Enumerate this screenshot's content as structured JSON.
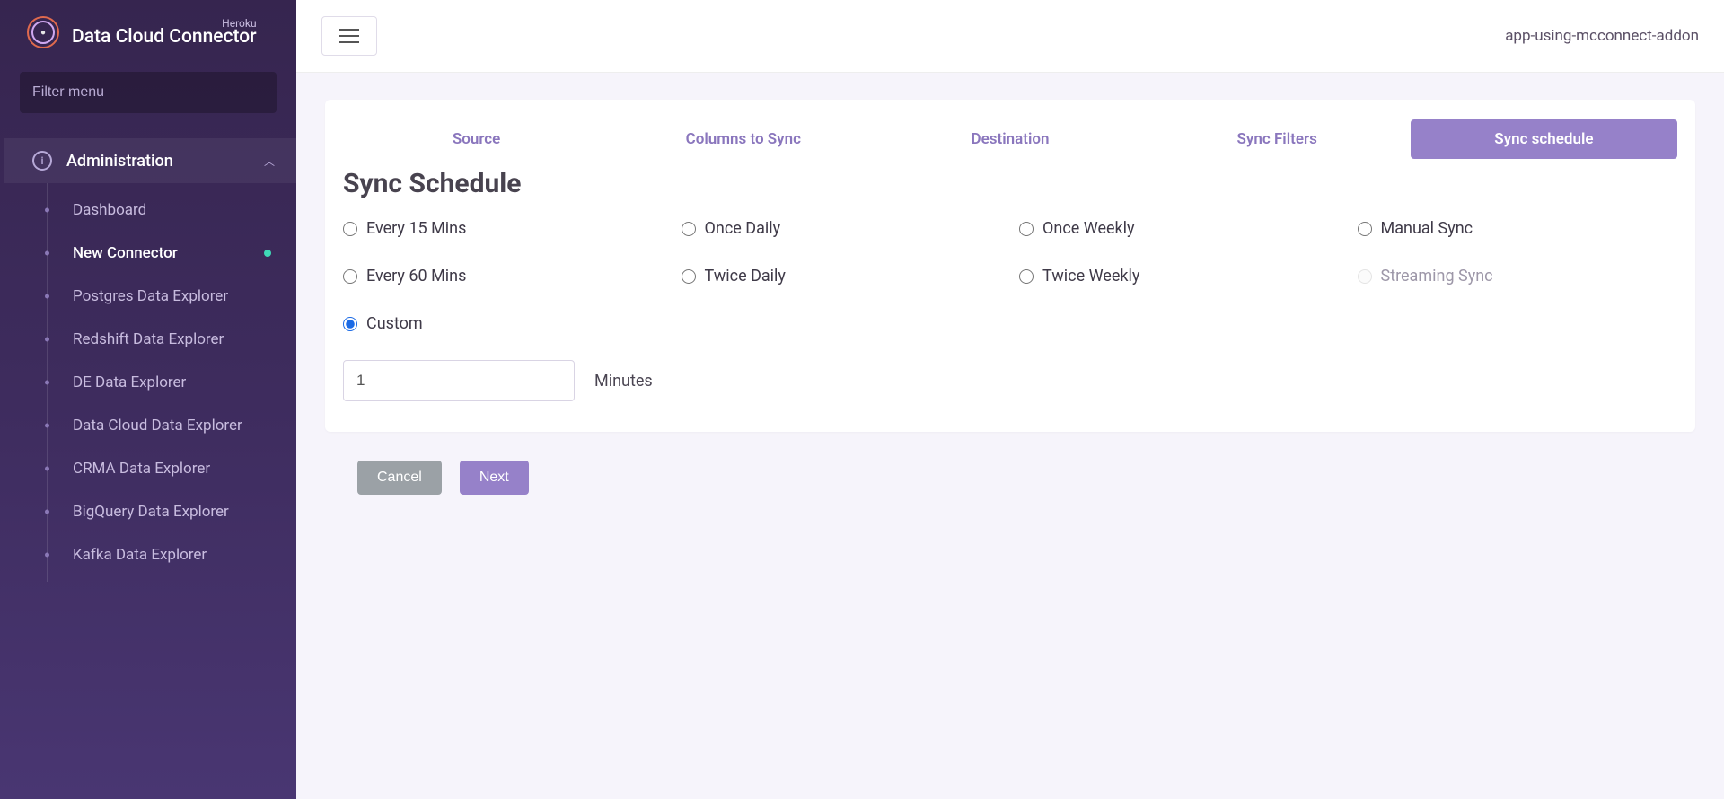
{
  "brand": {
    "overline": "Heroku",
    "title": "Data Cloud Connector"
  },
  "sidebar": {
    "filter_placeholder": "Filter menu",
    "section_label": "Administration",
    "items": [
      {
        "label": "Dashboard",
        "active": false,
        "badge": false
      },
      {
        "label": "New Connector",
        "active": true,
        "badge": true
      },
      {
        "label": "Postgres Data Explorer",
        "active": false,
        "badge": false
      },
      {
        "label": "Redshift Data Explorer",
        "active": false,
        "badge": false
      },
      {
        "label": "DE Data Explorer",
        "active": false,
        "badge": false
      },
      {
        "label": "Data Cloud Data Explorer",
        "active": false,
        "badge": false
      },
      {
        "label": "CRMA Data Explorer",
        "active": false,
        "badge": false
      },
      {
        "label": "BigQuery Data Explorer",
        "active": false,
        "badge": false
      },
      {
        "label": "Kafka Data Explorer",
        "active": false,
        "badge": false
      }
    ]
  },
  "header": {
    "app_name": "app-using-mcconnect-addon"
  },
  "tabs": [
    {
      "label": "Source",
      "active": false
    },
    {
      "label": "Columns to Sync",
      "active": false
    },
    {
      "label": "Destination",
      "active": false
    },
    {
      "label": "Sync Filters",
      "active": false
    },
    {
      "label": "Sync schedule",
      "active": true
    }
  ],
  "section_title": "Sync Schedule",
  "schedule_options": [
    {
      "label": "Every 15 Mins",
      "checked": false,
      "disabled": false
    },
    {
      "label": "Once Daily",
      "checked": false,
      "disabled": false
    },
    {
      "label": "Once Weekly",
      "checked": false,
      "disabled": false
    },
    {
      "label": "Manual Sync",
      "checked": false,
      "disabled": false
    },
    {
      "label": "Every 60 Mins",
      "checked": false,
      "disabled": false
    },
    {
      "label": "Twice Daily",
      "checked": false,
      "disabled": false
    },
    {
      "label": "Twice Weekly",
      "checked": false,
      "disabled": false
    },
    {
      "label": "Streaming Sync",
      "checked": false,
      "disabled": true
    },
    {
      "label": "Custom",
      "checked": true,
      "disabled": false
    }
  ],
  "custom": {
    "value": "1",
    "unit_label": "Minutes"
  },
  "buttons": {
    "cancel": "Cancel",
    "next": "Next"
  }
}
